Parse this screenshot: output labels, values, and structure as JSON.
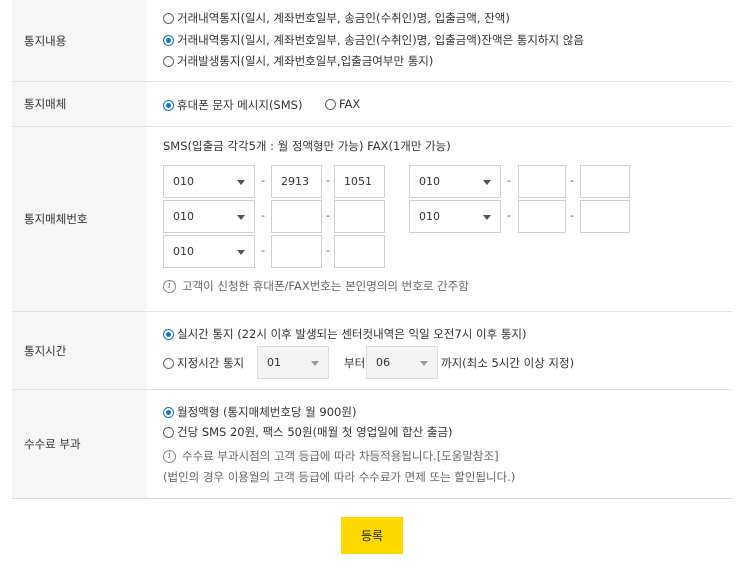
{
  "notify_content": {
    "label": "통지내용",
    "options": [
      {
        "text": "거래내역통지(일시, 계좌번호일부, 송금인(수취인)명, 입출금액, 잔액)",
        "selected": false
      },
      {
        "text": "거래내역통지(일시, 계좌번호일부, 송금인(수취인)명, 입출금액)잔액은 통지하지 않음",
        "selected": true
      },
      {
        "text": "거래발생통지(일시, 계좌번호일부,입출금여부만 통지)",
        "selected": false
      }
    ]
  },
  "notify_medium": {
    "label": "통지매체",
    "options": [
      {
        "text": "휴대폰 문자 메시지(SMS)",
        "selected": true
      },
      {
        "text": "FAX",
        "selected": false
      }
    ]
  },
  "notify_numbers": {
    "label": "통지매체번호",
    "description": "SMS(입출금 각각5개 : 월 정액형만 가능) FAX(1개만 가능)",
    "separator": "-",
    "sms_rows": [
      {
        "prefix": "010",
        "middle": "2913",
        "last": "1051"
      },
      {
        "prefix": "010",
        "middle": "",
        "last": ""
      },
      {
        "prefix": "010",
        "middle": "",
        "last": ""
      }
    ],
    "fax_rows": [
      {
        "prefix": "010",
        "middle": "",
        "last": ""
      },
      {
        "prefix": "010",
        "middle": "",
        "last": ""
      }
    ],
    "note": "고객이 신청한 휴대폰/FAX번호는 본인명의의 번호로 간주함"
  },
  "notify_time": {
    "label": "통지시간",
    "realtime": {
      "text": "실시간 통지 (22시 이후 발생되는 센터컷내역은 익일 오전7시 이후 통지)",
      "selected": true
    },
    "scheduled": {
      "text": "지정시간 통지",
      "selected": false
    },
    "from_value": "01",
    "from_label": "부터",
    "to_value": "06",
    "to_label": "까지(최소 5시간 이상 지정)"
  },
  "fee": {
    "label": "수수료 부과",
    "options": [
      {
        "text": "월정액형 (통지매체번호당 월 900원)",
        "selected": true
      },
      {
        "text": "건당 SMS 20원, 팩스 50원(매월 첫 영업일에 합산 출금)",
        "selected": false
      }
    ],
    "note1": "수수료 부과시점의 고객 등급에 따라 차등적용됩니다.[도움말참조]",
    "note2": "(법인의 경우 이용월의 고객 등급에 따라 수수료가 면제 또는 할인됩니다.)"
  },
  "submit_label": "등록",
  "colors": {
    "radio_selected": "#1a73c8",
    "button_bg": "#ffd800",
    "header_bg": "#f6f6f6"
  },
  "icons": {
    "info": "info-circle-icon"
  }
}
